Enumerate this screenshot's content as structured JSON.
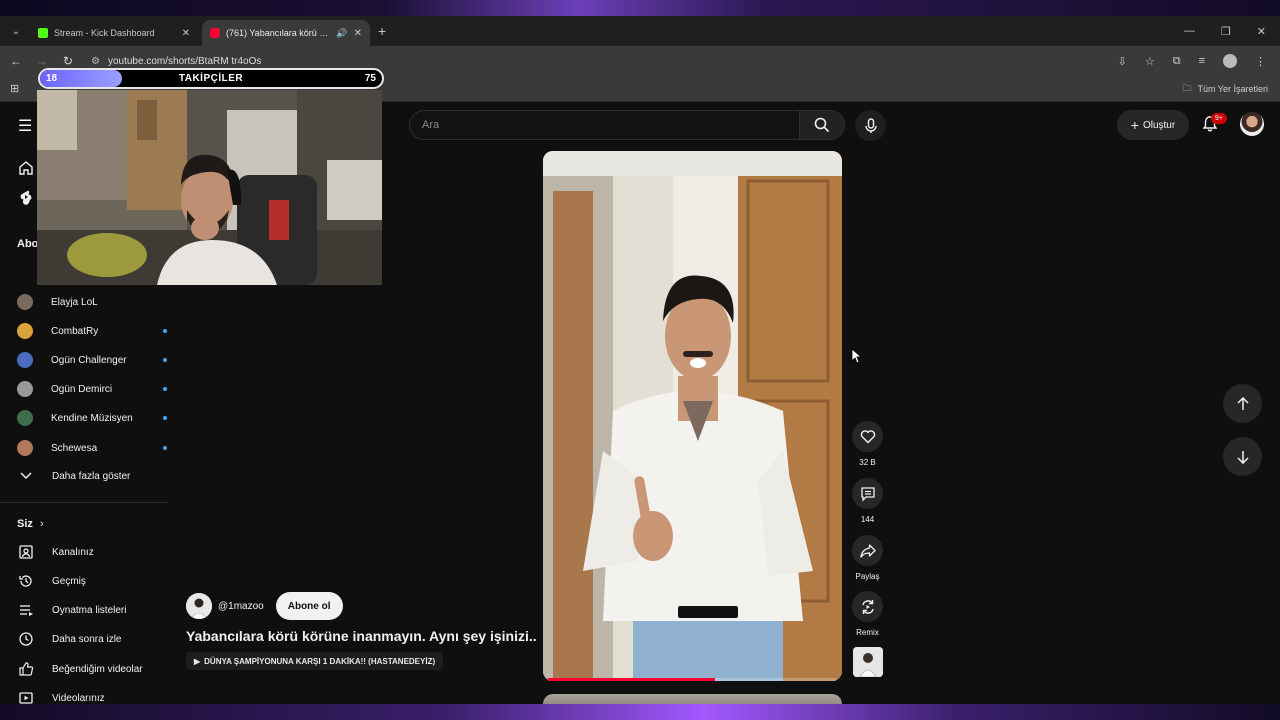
{
  "browser": {
    "tabs": [
      {
        "title": "Stream - Kick Dashboard",
        "favicon_color": "#53fc18",
        "active": false
      },
      {
        "title": "(761) Yabancılara körü körü",
        "favicon_color": "#ff0033",
        "active": true
      }
    ],
    "url": "youtube.com/shorts/BtaRM tr4oOs",
    "bookmarks_label": "Tüm Yer İşaretleri"
  },
  "overlay": {
    "followers_label": "TAKİPÇİLER",
    "current": "18",
    "goal": "75",
    "progress_fraction": 0.24
  },
  "youtube": {
    "search_placeholder": "Ara",
    "create_label": "Oluştur",
    "notification_count": "9+",
    "sidebar": {
      "subscriptions_heading": "Abo",
      "subscriptions": [
        {
          "name": "Elayja LoL",
          "new": false,
          "color": "#7a6a5c"
        },
        {
          "name": "CombatRy",
          "new": true,
          "color": "#d9a53a"
        },
        {
          "name": "Ogün Challenger",
          "new": true,
          "color": "#4b6cc1"
        },
        {
          "name": "Ogün Demirci",
          "new": true,
          "color": "#9a9a9a"
        },
        {
          "name": "Kendine Müzisyen",
          "new": true,
          "color": "#3f6e4a"
        },
        {
          "name": "Schewesa",
          "new": true,
          "color": "#b07a5a"
        }
      ],
      "show_more": "Daha fazla göster",
      "you_heading": "Siz",
      "you_items": [
        {
          "label": "Kanalınız",
          "icon": "channel-icon"
        },
        {
          "label": "Geçmiş",
          "icon": "history-icon"
        },
        {
          "label": "Oynatma listeleri",
          "icon": "playlist-icon"
        },
        {
          "label": "Daha sonra izle",
          "icon": "watch-later-icon"
        },
        {
          "label": "Beğendiğim videolar",
          "icon": "liked-icon"
        },
        {
          "label": "Videolarınız",
          "icon": "your-videos-icon"
        }
      ]
    },
    "short": {
      "channel": "@1mazoo",
      "subscribe_label": "Abone ol",
      "title": "Yabancılara körü körüne inanmayın. Aynı şey işinizi...",
      "related_video": "DÜNYA ŞAMPİYONUNA KARŞI 1 DAKİKA!! (HASTANEDEYİZ)",
      "likes": "32 B",
      "comments": "144",
      "share_label": "Paylaş",
      "remix_label": "Remix",
      "progress_fraction": 0.58
    }
  }
}
